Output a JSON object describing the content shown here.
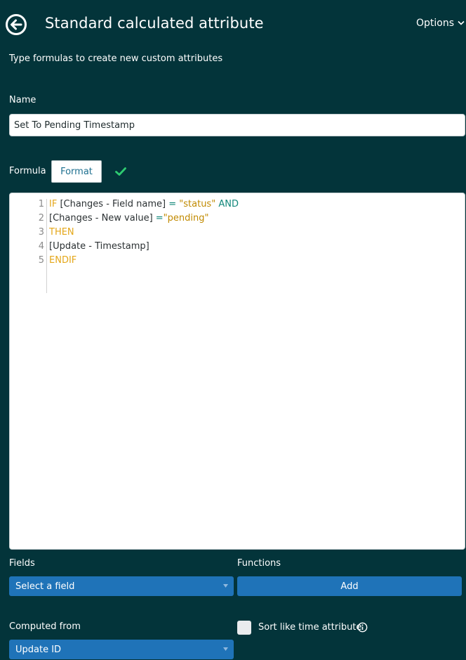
{
  "header": {
    "title": "Standard calculated attribute",
    "options_label": "Options"
  },
  "subtitle": "Type formulas to create new custom attributes",
  "name_section": {
    "label": "Name",
    "value": "Set To Pending Timestamp"
  },
  "formula_section": {
    "label": "Formula",
    "format_button": "Format"
  },
  "editor": {
    "line_numbers": [
      "1",
      "2",
      "3",
      "4",
      "5"
    ],
    "tokens": {
      "l1_if": "IF ",
      "l1_field": "[Changes - Field name]",
      "l1_op": " = ",
      "l1_str": "\"status\"",
      "l1_and": " AND",
      "l2_field": "[Changes - New value]",
      "l2_op": " =",
      "l2_str": "\"pending\"",
      "l3_then": "THEN",
      "l4_field": "[Update - Timestamp]",
      "l5_endif": "ENDIF"
    }
  },
  "fields": {
    "label": "Fields",
    "select_value": "Select a field"
  },
  "functions": {
    "label": "Functions",
    "add_button": "Add"
  },
  "computed_from": {
    "label": "Computed from",
    "select_value": "Update ID"
  },
  "sort_option": {
    "label": "Sort like time attribute",
    "checked": false
  },
  "colors": {
    "background": "#03343a",
    "accent_blue": "#1f73b8",
    "keyword": "#e4a71a",
    "operator": "#11877a",
    "string": "#c18a00",
    "check_green": "#2ecc71"
  }
}
